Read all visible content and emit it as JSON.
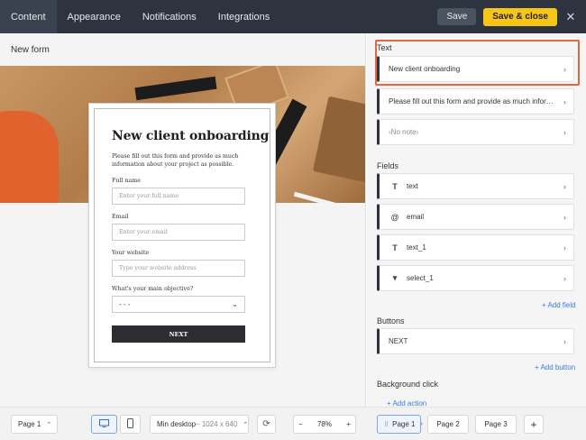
{
  "topbar": {
    "tabs": [
      {
        "label": "Content"
      },
      {
        "label": "Appearance"
      },
      {
        "label": "Notifications"
      },
      {
        "label": "Integrations"
      }
    ],
    "save_label": "Save",
    "save_close_label": "Save & close",
    "close_icon": "close-icon"
  },
  "canvas": {
    "form_name": "New form",
    "form": {
      "title": "New client onboarding",
      "description": "Please fill out this form and provide as much information about your project as possible.",
      "fields": [
        {
          "label": "Full name",
          "placeholder": "Enter your full name"
        },
        {
          "label": "Email",
          "placeholder": "Enter your email"
        },
        {
          "label": "Your website",
          "placeholder": "Type your website address"
        }
      ],
      "select": {
        "label": "What's your main objective?",
        "value": "- - -"
      },
      "next_label": "NEXT"
    }
  },
  "panel": {
    "text_title": "Text",
    "text_rows": [
      {
        "label": "New client onboarding"
      },
      {
        "label": "Please fill out this form and provide as much informa..."
      },
      {
        "label": "‹No note›"
      }
    ],
    "fields_title": "Fields",
    "field_rows": [
      {
        "icon": "T",
        "label": "text"
      },
      {
        "icon": "@",
        "label": "email"
      },
      {
        "icon": "T",
        "label": "text_1"
      },
      {
        "icon": "▾",
        "label": "select_1"
      }
    ],
    "add_field": "+ Add field",
    "buttons_title": "Buttons",
    "button_rows": [
      {
        "label": "NEXT"
      }
    ],
    "add_button": "+ Add button",
    "background_title": "Background click",
    "add_action": "+ Add action"
  },
  "bottombar": {
    "page_select": "Page 1",
    "device_desktop_icon": "desktop-icon",
    "device_mobile_icon": "mobile-icon",
    "preset_label": "Min desktop",
    "preset_size": "– 1024 x 640",
    "refresh_icon": "refresh-icon",
    "zoom_minus": "−",
    "zoom": "78%",
    "zoom_plus": "+",
    "pages": [
      {
        "label": "Page 1",
        "active": true
      },
      {
        "label": "Page 2",
        "active": false
      },
      {
        "label": "Page 3",
        "active": false
      }
    ],
    "add_page": "+"
  },
  "colors": {
    "topbar_bg": "#2d3440",
    "accent_yellow": "#f5c518",
    "highlight_orange": "#e4653f",
    "link_blue": "#3b7be0"
  }
}
